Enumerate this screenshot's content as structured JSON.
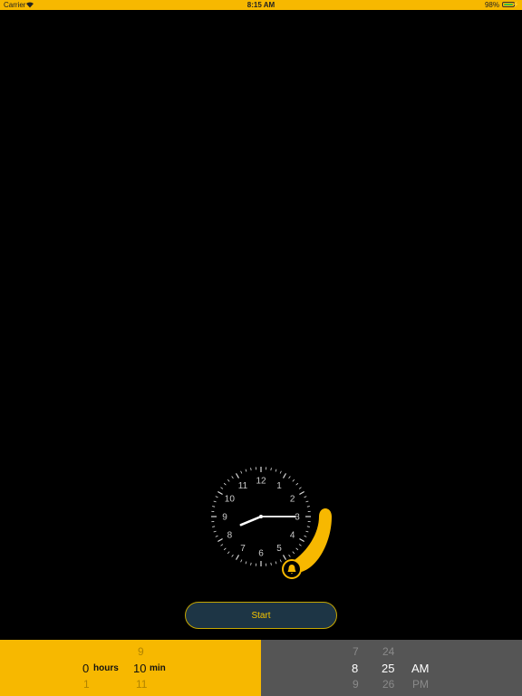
{
  "status_bar": {
    "carrier": "Carrier",
    "time": "8:15 AM",
    "battery": "98%",
    "battery_level": 0.98
  },
  "clock": {
    "numerals": [
      "12",
      "1",
      "2",
      "3",
      "4",
      "5",
      "6",
      "7",
      "8",
      "9",
      "10",
      "11"
    ],
    "shown_time": "8:15",
    "alarm_icon": "bell-icon",
    "accent_color": "#f7b800"
  },
  "start_button": {
    "label": "Start"
  },
  "duration_picker": {
    "hours": {
      "above": "",
      "selected": "0",
      "below": "1",
      "unit": "hours"
    },
    "minutes": {
      "above": "9",
      "selected": "10",
      "below": "11",
      "unit": "min"
    }
  },
  "time_picker": {
    "hour": {
      "above": "7",
      "selected": "8",
      "below": "9"
    },
    "minute": {
      "above": "24",
      "selected": "25",
      "below": "26"
    },
    "period": {
      "selected": "AM",
      "below": "PM"
    }
  }
}
